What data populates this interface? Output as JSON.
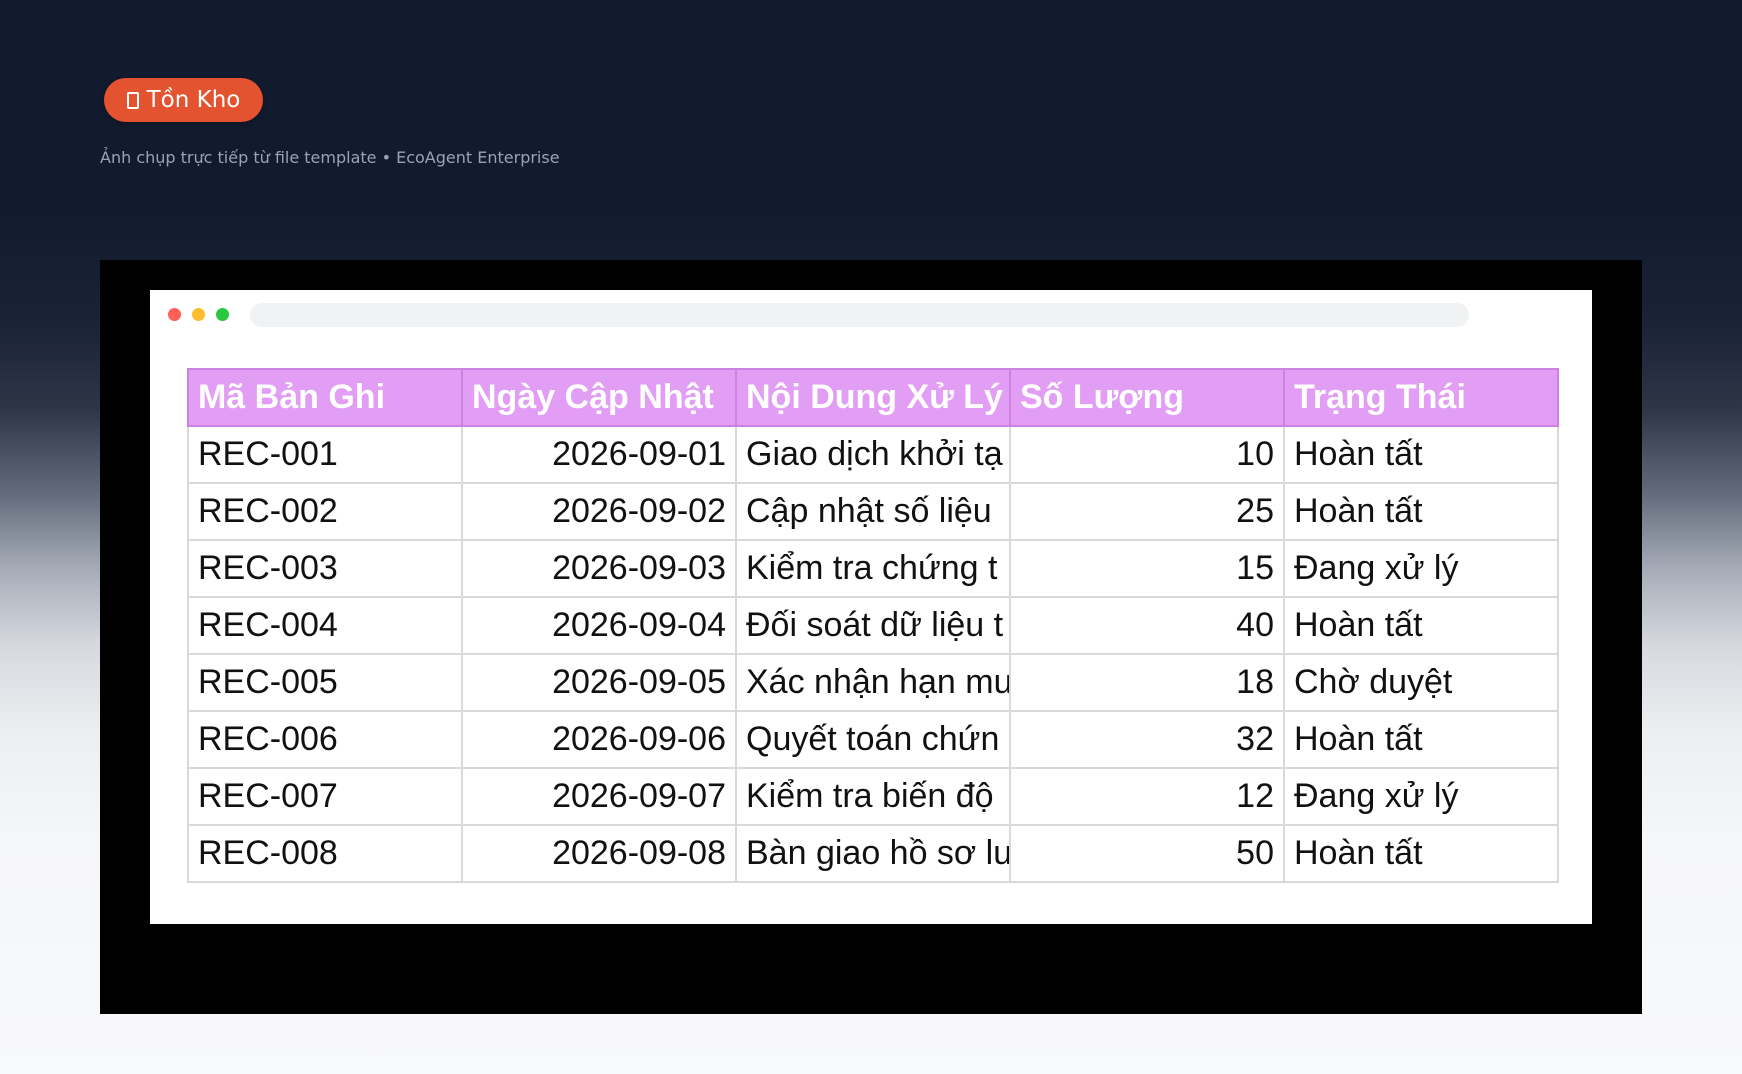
{
  "badge": {
    "icon": "box-icon",
    "label": "Tồn Kho",
    "color": "#e4532f"
  },
  "subtitle": "Ảnh chụp trực tiếp từ file template • EcoAgent Enterprise",
  "window": {
    "controls": [
      "close-dot",
      "minimize-dot",
      "maximize-dot"
    ]
  },
  "table": {
    "header_color": "#e29df4",
    "columns": [
      "Mã Bản Ghi",
      "Ngày Cập Nhật",
      "Nội Dung Xử Lý",
      "Số Lượng",
      "Trạng Thái"
    ],
    "rows": [
      [
        "REC-001",
        "2026-09-01",
        "Giao dịch khởi tạ",
        "10",
        "Hoàn tất"
      ],
      [
        "REC-002",
        "2026-09-02",
        "Cập nhật số liệu",
        "25",
        "Hoàn tất"
      ],
      [
        "REC-003",
        "2026-09-03",
        "Kiểm tra chứng t",
        "15",
        "Đang xử lý"
      ],
      [
        "REC-004",
        "2026-09-04",
        "Đối soát dữ liệu t",
        "40",
        "Hoàn tất"
      ],
      [
        "REC-005",
        "2026-09-05",
        "Xác nhận hạn mu",
        "18",
        "Chờ duyệt"
      ],
      [
        "REC-006",
        "2026-09-06",
        "Quyết toán chứn",
        "32",
        "Hoàn tất"
      ],
      [
        "REC-007",
        "2026-09-07",
        "Kiểm tra biến độ",
        "12",
        "Đang xử lý"
      ],
      [
        "REC-008",
        "2026-09-08",
        "Bàn giao hồ sơ lư",
        "50",
        "Hoàn tất"
      ]
    ]
  }
}
